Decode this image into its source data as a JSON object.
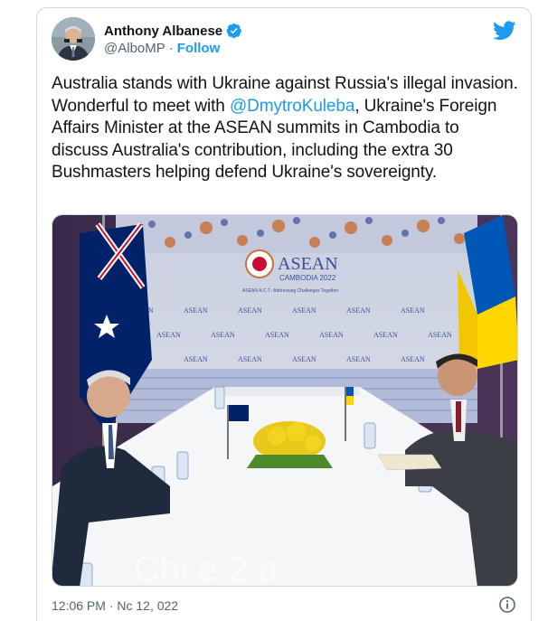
{
  "author": {
    "name": "Anthony Albanese",
    "handle": "@AlboMP",
    "separator": "·",
    "follow_label": "Follow"
  },
  "tweet": {
    "text_before": "Australia stands with Ukraine against Russia's illegal invasion. Wonderful to meet with ",
    "mention": "@DmytroKuleba",
    "text_after": ", Ukraine's Foreign Affairs Minister at the ASEAN summits in Cambodia to discuss Australia's contribution, including the extra 30 Bushmasters helping defend Ukraine's sovereignty."
  },
  "photo": {
    "banner_title": "ASEAN",
    "banner_subtitle": "CAMBODIA 2022",
    "banner_tagline": "ASEAN A.C.T.: Addressing Challenges Together",
    "backdrop_word": "ASEAN",
    "watermark": "Chi   e  2 a  "
  },
  "meta": {
    "timestamp": "12:06 PM · Nc    12, 022"
  },
  "icons": {
    "verified": "verified-badge-icon",
    "logo": "twitter-bird-icon",
    "info": "info-icon"
  },
  "colors": {
    "accent": "#1d9bf0",
    "text": "#0f1419",
    "muted": "#536471"
  }
}
